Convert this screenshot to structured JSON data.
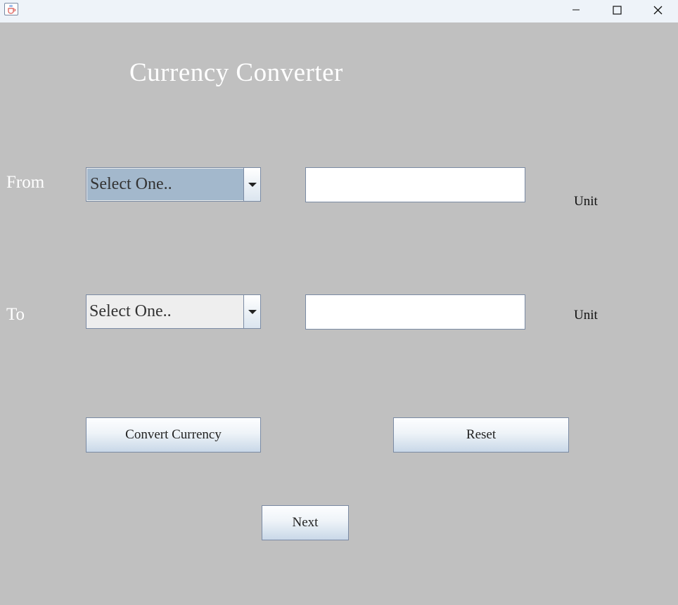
{
  "window": {
    "icon": "java-cup-icon",
    "controls": {
      "minimize": "—",
      "maximize": "☐",
      "close": "✕"
    }
  },
  "title": "Currency Converter",
  "from": {
    "label": "From",
    "currency_select": "Select One..",
    "amount_value": "",
    "unit_label": "Unit"
  },
  "to": {
    "label": "To",
    "currency_select": "Select One..",
    "amount_value": "",
    "unit_label": "Unit"
  },
  "buttons": {
    "convert": "Convert Currency",
    "reset": "Reset",
    "next": "Next"
  },
  "colors": {
    "panel_background": "#c0c0c0",
    "title_text": "#ffffff",
    "focused_combo": "#a3b8cc"
  }
}
